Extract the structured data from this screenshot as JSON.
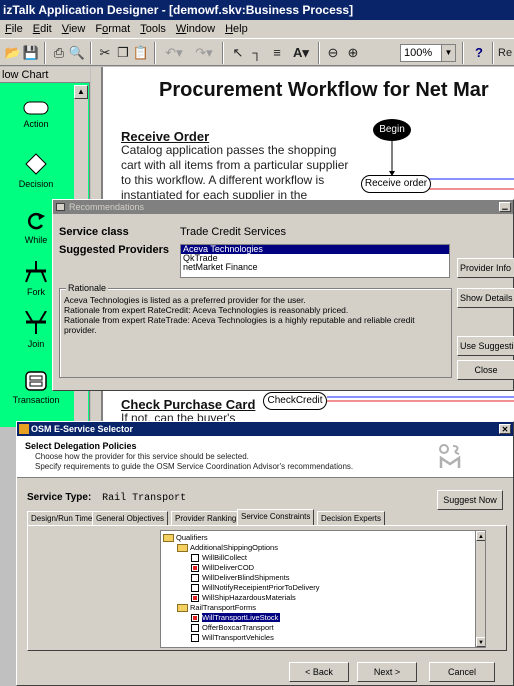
{
  "window": {
    "title": "izTalk Application Designer - [demowf.skv:Business Process]"
  },
  "menu": [
    {
      "pre": "",
      "u": "F",
      "post": "ile"
    },
    {
      "pre": "",
      "u": "E",
      "post": "dit"
    },
    {
      "pre": "",
      "u": "V",
      "post": "iew"
    },
    {
      "pre": "F",
      "u": "o",
      "post": "rmat"
    },
    {
      "pre": "",
      "u": "T",
      "post": "ools"
    },
    {
      "pre": "",
      "u": "W",
      "post": "indow"
    },
    {
      "pre": "",
      "u": "H",
      "post": "elp"
    }
  ],
  "toolbar": {
    "zoom": "100%",
    "font_button": "A",
    "help_button": "?",
    "overflow_text": "Re"
  },
  "palette": {
    "header": "low Chart",
    "items": [
      {
        "label": "Action",
        "icon": "action-icon"
      },
      {
        "label": "Decision",
        "icon": "decision-icon"
      },
      {
        "label": "While",
        "icon": "while-icon"
      },
      {
        "label": "Fork",
        "icon": "fork-icon"
      },
      {
        "label": "Join",
        "icon": "join-icon"
      },
      {
        "label": "Transaction",
        "icon": "transaction-icon"
      }
    ]
  },
  "canvas": {
    "title": "Procurement Workflow for Net Mar",
    "sections": [
      {
        "heading": "Receive Order",
        "lines": [
          "Catalog application passes the shopping",
          "cart with all items from a particular supplier",
          "to this workflow. A different workflow is",
          "instantiated for each supplier in the"
        ]
      },
      {
        "heading": "Check Purchase Card",
        "lines": [
          "If not, can the buyer's"
        ]
      }
    ],
    "nodes": {
      "begin": "Begin",
      "receive": "Receive order",
      "check": "CheckCredit"
    }
  },
  "recommendations": {
    "title": "Recommendations",
    "service_class_label": "Service class",
    "service_class_value": "Trade Credit Services",
    "providers_label": "Suggested Providers",
    "providers": [
      "Aceva Technologies",
      "QkTrade",
      "netMarket Finance"
    ],
    "selected_provider": 0,
    "rationale_label": "Rationale",
    "rationale_lines": [
      "Aceva Technologies is listed as a preferred provider for the user.",
      "Rationale from expert RateCredit: Aceva Technologies is reasonably priced.",
      "Rationale from expert RateTrade: Aceva Technologies is a highly reputable and reliable credit",
      "provider."
    ],
    "buttons": {
      "provider_info": "Provider Info",
      "show_details": "Show Details",
      "use_suggestion": "Use Suggestion",
      "close": "Close"
    }
  },
  "osm": {
    "title": "OSM E-Service Selector",
    "header_title": "Select Delegation Policies",
    "header_line1": "Choose how the provider for this service should be selected.",
    "header_line2": "Specify requirements to guide the OSM Service Coordination Advisor's recommendations.",
    "service_type_label": "Service Type:",
    "service_type_value": "Rail Transport",
    "suggest_now": "Suggest Now",
    "tabs": [
      "Design/Run Time",
      "General Objectives",
      "Provider Ranking",
      "Service Constraints",
      "Decision Experts"
    ],
    "active_tab": 3,
    "tree": [
      {
        "type": "folder",
        "level": 0,
        "label": "Qualifiers"
      },
      {
        "type": "folder",
        "level": 1,
        "label": "AdditionalShippingOptions"
      },
      {
        "type": "check",
        "level": 2,
        "label": "WillBillCollect",
        "checked": false
      },
      {
        "type": "check",
        "level": 2,
        "label": "WillDeliverCOD",
        "checked": true
      },
      {
        "type": "check",
        "level": 2,
        "label": "WillDeliverBlindShipments",
        "checked": false
      },
      {
        "type": "check",
        "level": 2,
        "label": "WillNotifyReceipientPriorToDelivery",
        "checked": false
      },
      {
        "type": "check",
        "level": 2,
        "label": "WillShipHazardousMaterials",
        "checked": true
      },
      {
        "type": "folder",
        "level": 1,
        "label": "RailTransportForms"
      },
      {
        "type": "check",
        "level": 2,
        "label": "WillTransportLiveStock",
        "checked": true,
        "highlight": true
      },
      {
        "type": "check",
        "level": 2,
        "label": "OfferBoxcarTransport",
        "checked": false
      },
      {
        "type": "check",
        "level": 2,
        "label": "WillTransportVehicles",
        "checked": false
      }
    ],
    "buttons": {
      "back": "< Back",
      "next": "Next >",
      "cancel": "Cancel"
    }
  },
  "colors": {
    "titlebar": "#0a246a",
    "palette": "#00ff80",
    "selection": "#000080",
    "check_mark": "#e02020"
  }
}
